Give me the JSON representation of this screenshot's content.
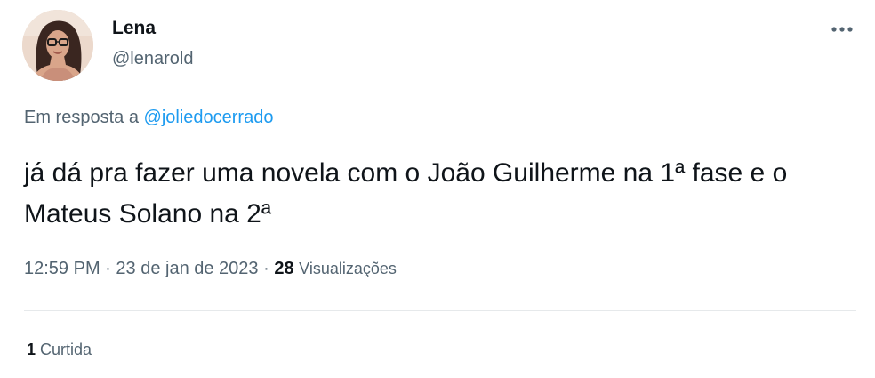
{
  "author": {
    "display_name": "Lena",
    "handle": "@lenarold",
    "avatar_icon": "profile-photo"
  },
  "reply": {
    "prefix": "Em resposta a",
    "mention": "@joliedocerrado"
  },
  "tweet": {
    "text": "já dá pra fazer uma novela com o João Guilherme na 1ª fase e o Mateus Solano na 2ª"
  },
  "meta": {
    "time": "12:59 PM",
    "separator": "·",
    "date": "23 de jan de 2023",
    "views_count": "28",
    "views_label": "Visualizações"
  },
  "engagement": {
    "likes_count": "1",
    "likes_label": "Curtida"
  },
  "colors": {
    "text_primary": "#0f1419",
    "text_secondary": "#536471",
    "link": "#1d9bf0",
    "divider": "#e6e9eb"
  },
  "icons": {
    "more": "more-horizontal-icon"
  }
}
